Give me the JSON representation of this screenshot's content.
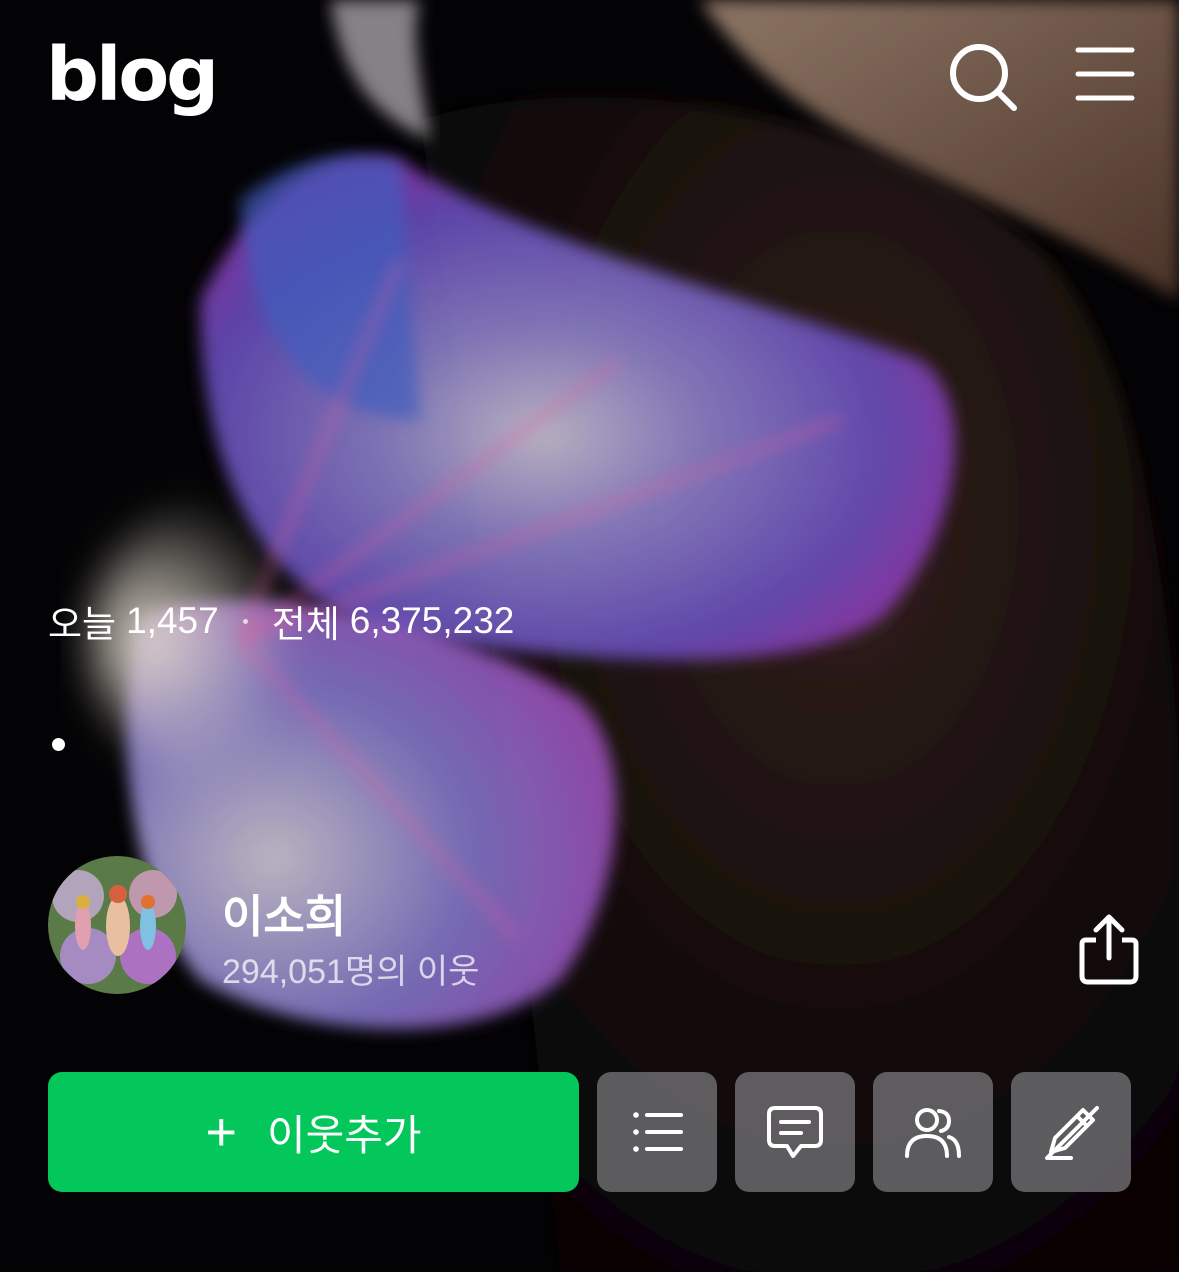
{
  "header": {
    "logo_text": "blog",
    "search_icon": "search-icon",
    "menu_icon": "hamburger-menu-icon"
  },
  "stats": {
    "today_label": "오늘",
    "today_count": "1,457",
    "total_label": "전체",
    "total_count": "6,375,232"
  },
  "profile": {
    "name": "이소희",
    "neighbors": "294,051명의 이웃",
    "share_icon": "share-icon"
  },
  "actions": {
    "add_neighbor_label": "이웃추가",
    "add_neighbor_icon": "plus-icon",
    "list_icon": "list-icon",
    "guestbook_icon": "chat-bubble-icon",
    "neighbors_icon": "people-icon",
    "write_icon": "pen-off-icon"
  },
  "colors": {
    "accent_green": "#03c75a",
    "icon_button_bg": "#6e6e72"
  }
}
